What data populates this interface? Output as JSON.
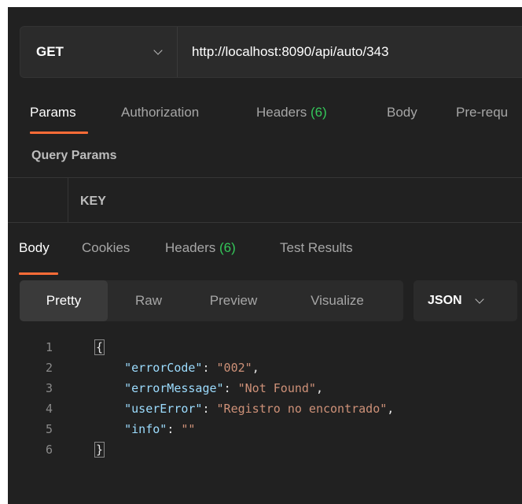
{
  "request": {
    "method": "GET",
    "url": "http://localhost:8090/api/auto/343"
  },
  "request_tabs": [
    {
      "label": "Params",
      "count": ""
    },
    {
      "label": "Authorization",
      "count": ""
    },
    {
      "label": "Headers",
      "count": "(6)"
    },
    {
      "label": "Body",
      "count": ""
    },
    {
      "label": "Pre-requ",
      "count": ""
    }
  ],
  "query_params": {
    "title": "Query Params",
    "key_header": "KEY"
  },
  "response_tabs": [
    {
      "label": "Body",
      "count": ""
    },
    {
      "label": "Cookies",
      "count": ""
    },
    {
      "label": "Headers",
      "count": "(6)"
    },
    {
      "label": "Test Results",
      "count": ""
    }
  ],
  "view_modes": [
    "Pretty",
    "Raw",
    "Preview",
    "Visualize"
  ],
  "format": "JSON",
  "code_lines": [
    {
      "n": "1",
      "parts": [
        {
          "t": "{",
          "c": "brace"
        }
      ]
    },
    {
      "n": "2",
      "parts": [
        {
          "t": "    ",
          "c": "p"
        },
        {
          "t": "\"errorCode\"",
          "c": "k"
        },
        {
          "t": ": ",
          "c": "p"
        },
        {
          "t": "\"002\"",
          "c": "s"
        },
        {
          "t": ",",
          "c": "p"
        }
      ]
    },
    {
      "n": "3",
      "parts": [
        {
          "t": "    ",
          "c": "p"
        },
        {
          "t": "\"errorMessage\"",
          "c": "k"
        },
        {
          "t": ": ",
          "c": "p"
        },
        {
          "t": "\"Not Found\"",
          "c": "s"
        },
        {
          "t": ",",
          "c": "p"
        }
      ]
    },
    {
      "n": "4",
      "parts": [
        {
          "t": "    ",
          "c": "p"
        },
        {
          "t": "\"userError\"",
          "c": "k"
        },
        {
          "t": ": ",
          "c": "p"
        },
        {
          "t": "\"Registro no encontrado\"",
          "c": "s"
        },
        {
          "t": ",",
          "c": "p"
        }
      ]
    },
    {
      "n": "5",
      "parts": [
        {
          "t": "    ",
          "c": "p"
        },
        {
          "t": "\"info\"",
          "c": "k"
        },
        {
          "t": ": ",
          "c": "p"
        },
        {
          "t": "\"\"",
          "c": "s"
        }
      ]
    },
    {
      "n": "6",
      "parts": [
        {
          "t": "}",
          "c": "brace"
        }
      ]
    }
  ],
  "colors": {
    "background": "#212121",
    "accent": "#ff6c37",
    "count_green": "#34c759",
    "json_key": "#9cdcfe",
    "json_string": "#ce9178"
  }
}
